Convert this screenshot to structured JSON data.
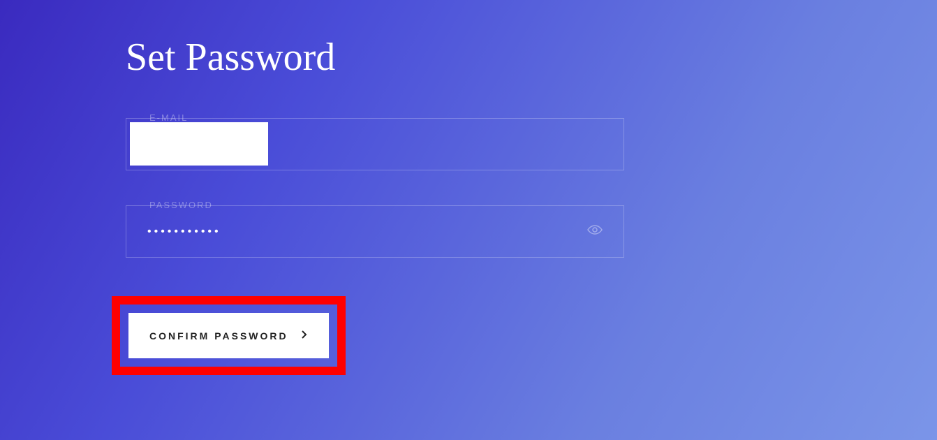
{
  "page": {
    "title": "Set Password"
  },
  "form": {
    "email": {
      "label": "E-MAIL",
      "value": ""
    },
    "password": {
      "label": "PASSWORD",
      "value": "•••••••••••"
    }
  },
  "button": {
    "confirm_label": "CONFIRM PASSWORD"
  }
}
